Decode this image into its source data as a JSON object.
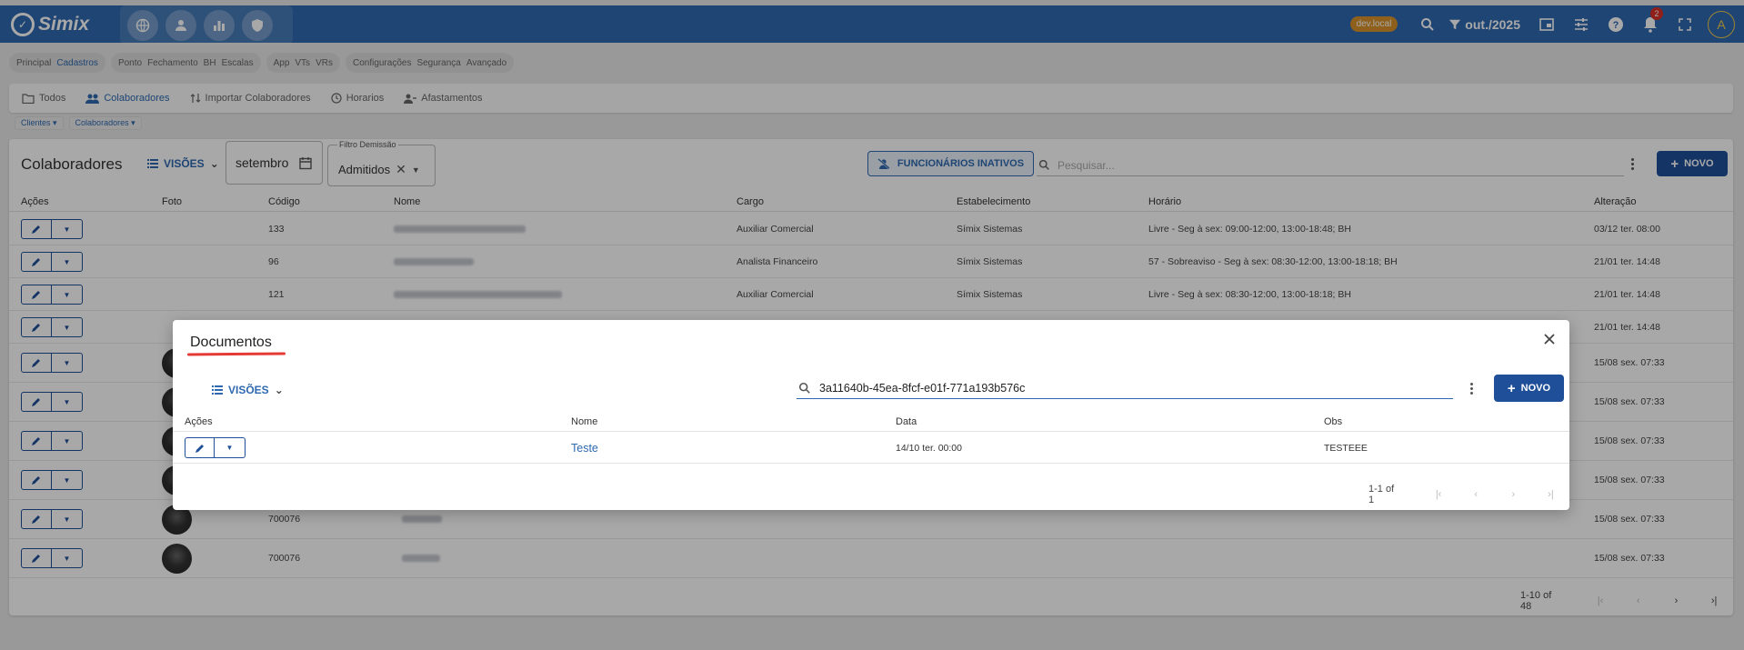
{
  "app": {
    "brand": "Simix",
    "env_badge": "dev.local",
    "period": "out./2025",
    "notif_count": "2",
    "user_initial": "A"
  },
  "topbar_icons": [
    "globe-icon",
    "person-icon",
    "bar-chart-icon",
    "shield-icon"
  ],
  "modules": [
    {
      "items": [
        "Principal",
        "Cadastros"
      ],
      "active": "Cadastros"
    },
    {
      "items": [
        "Ponto",
        "Fechamento",
        "BH",
        "Escalas"
      ]
    },
    {
      "items": [
        "App",
        "VTs",
        "VRs"
      ]
    },
    {
      "items": [
        "Configurações",
        "Segurança",
        "Avançado"
      ]
    }
  ],
  "subtabs": {
    "todos": "Todos",
    "colaboradores": "Colaboradores",
    "importar": "Importar Colaboradores",
    "horarios": "Horarios",
    "afastamentos": "Afastamentos"
  },
  "breadcrumb": {
    "clientes": "Clientes",
    "colaboradores": "Colaboradores"
  },
  "main": {
    "title": "Colaboradores",
    "views_label": "VISÕES",
    "month_value": "setembro",
    "filter_label": "Filtro Demissão",
    "filter_value": "Admitidos",
    "inactive_button": "FUNCIONÁRIOS INATIVOS",
    "search_placeholder": "Pesquisar...",
    "new_label": "NOVO",
    "columns": {
      "acoes": "Ações",
      "foto": "Foto",
      "codigo": "Código",
      "nome": "Nome",
      "cargo": "Cargo",
      "estab": "Estabelecimento",
      "horario": "Horário",
      "alteracao": "Alteração"
    },
    "rows": [
      {
        "codigo": "133",
        "cargo": "Auxiliar Comercial",
        "estab": "Símix Sistemas",
        "horario": "Livre - Seg à sex: 09:00-12:00, 13:00-18:48; BH",
        "alteracao": "03/12 ter. 08:00"
      },
      {
        "codigo": "96",
        "cargo": "Analista Financeiro",
        "estab": "Símix Sistemas",
        "horario": "57 - Sobreaviso - Seg à sex: 08:30-12:00, 13:00-18:18; BH",
        "alteracao": "21/01 ter. 14:48"
      },
      {
        "codigo": "121",
        "cargo": "Auxiliar Comercial",
        "estab": "Símix Sistemas",
        "horario": "Livre - Seg à sex: 08:30-12:00, 13:00-18:18; BH",
        "alteracao": "21/01 ter. 14:48"
      },
      {
        "codigo": "",
        "cargo": "",
        "estab": "",
        "horario": "",
        "alteracao": "21/01 ter. 14:48"
      },
      {
        "codigo": "",
        "cargo": "",
        "estab": "",
        "horario": "",
        "alteracao": "15/08 sex. 07:33"
      },
      {
        "codigo": "",
        "cargo": "",
        "estab": "",
        "horario": "",
        "alteracao": "15/08 sex. 07:33"
      },
      {
        "codigo": "",
        "cargo": "",
        "estab": "",
        "horario": "",
        "alteracao": "15/08 sex. 07:33"
      },
      {
        "codigo": "",
        "cargo": "",
        "estab": "",
        "horario": "",
        "alteracao": "15/08 sex. 07:33"
      },
      {
        "codigo": "700076",
        "cargo": "",
        "estab": "",
        "horario": "",
        "alteracao": "15/08 sex. 07:33"
      },
      {
        "codigo": "700076",
        "cargo": "",
        "estab": "",
        "horario": "",
        "alteracao": "15/08 sex. 07:33"
      }
    ],
    "pagination": "1-10 of 48"
  },
  "dialog": {
    "title": "Documentos",
    "views_label": "VISÕES",
    "search_value": "3a11640b-45ea-8fcf-e01f-771a193b576c",
    "new_label": "NOVO",
    "columns": {
      "acoes": "Ações",
      "nome": "Nome",
      "data": "Data",
      "obs": "Obs"
    },
    "rows": [
      {
        "nome": "Teste",
        "data": "14/10 ter. 00:00",
        "obs": "TESTEEE"
      }
    ],
    "pagination": "1-1 of 1"
  }
}
